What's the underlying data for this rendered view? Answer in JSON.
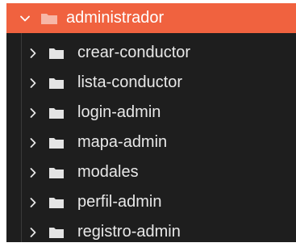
{
  "explorer": {
    "root": {
      "label": "administrador",
      "expanded": true
    },
    "children": [
      {
        "label": "crear-conductor"
      },
      {
        "label": "lista-conductor"
      },
      {
        "label": "login-admin"
      },
      {
        "label": "mapa-admin"
      },
      {
        "label": "modales"
      },
      {
        "label": "perfil-admin"
      },
      {
        "label": "registro-admin"
      }
    ]
  },
  "colors": {
    "selection": "#f0623f",
    "background": "#1e1e1e",
    "folder_icon": "#e4e4e4",
    "text": "#e8e8e8"
  },
  "icons": {
    "expanded": "chevron-down-icon",
    "collapsed": "chevron-right-icon",
    "folder": "folder-icon"
  }
}
